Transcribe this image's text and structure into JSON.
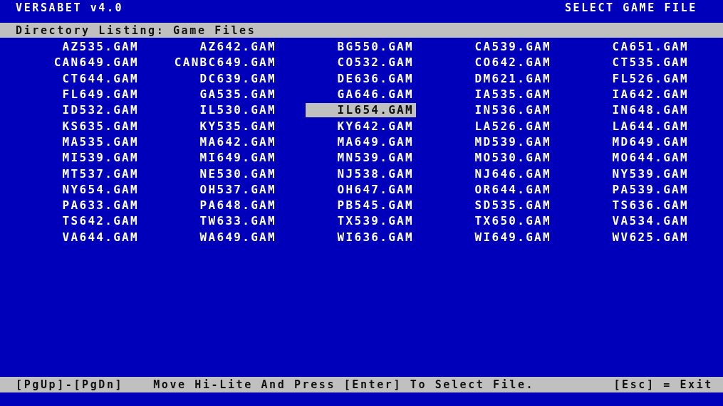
{
  "header": {
    "app_title": "VERSABET v4.0",
    "screen_title": "SELECT GAME FILE"
  },
  "listing": {
    "heading": "Directory Listing: Game Files",
    "files": [
      {
        "name": "AZ535.GAM",
        "selected": false
      },
      {
        "name": "AZ642.GAM",
        "selected": false
      },
      {
        "name": "BG550.GAM",
        "selected": false
      },
      {
        "name": "CA539.GAM",
        "selected": false
      },
      {
        "name": "CA651.GAM",
        "selected": false
      },
      {
        "name": "CAN649.GAM",
        "selected": false
      },
      {
        "name": "CANBC649.GAM",
        "selected": false
      },
      {
        "name": "CO532.GAM",
        "selected": false
      },
      {
        "name": "CO642.GAM",
        "selected": false
      },
      {
        "name": "CT535.GAM",
        "selected": false
      },
      {
        "name": "CT644.GAM",
        "selected": false
      },
      {
        "name": "DC639.GAM",
        "selected": false
      },
      {
        "name": "DE636.GAM",
        "selected": false
      },
      {
        "name": "DM621.GAM",
        "selected": false
      },
      {
        "name": "FL526.GAM",
        "selected": false
      },
      {
        "name": "FL649.GAM",
        "selected": false
      },
      {
        "name": "GA535.GAM",
        "selected": false
      },
      {
        "name": "GA646.GAM",
        "selected": false
      },
      {
        "name": "IA535.GAM",
        "selected": false
      },
      {
        "name": "IA642.GAM",
        "selected": false
      },
      {
        "name": "ID532.GAM",
        "selected": false
      },
      {
        "name": "IL530.GAM",
        "selected": false
      },
      {
        "name": "IL654.GAM",
        "selected": true
      },
      {
        "name": "IN536.GAM",
        "selected": false
      },
      {
        "name": "IN648.GAM",
        "selected": false
      },
      {
        "name": "KS635.GAM",
        "selected": false
      },
      {
        "name": "KY535.GAM",
        "selected": false
      },
      {
        "name": "KY642.GAM",
        "selected": false
      },
      {
        "name": "LA526.GAM",
        "selected": false
      },
      {
        "name": "LA644.GAM",
        "selected": false
      },
      {
        "name": "MA535.GAM",
        "selected": false
      },
      {
        "name": "MA642.GAM",
        "selected": false
      },
      {
        "name": "MA649.GAM",
        "selected": false
      },
      {
        "name": "MD539.GAM",
        "selected": false
      },
      {
        "name": "MD649.GAM",
        "selected": false
      },
      {
        "name": "MI539.GAM",
        "selected": false
      },
      {
        "name": "MI649.GAM",
        "selected": false
      },
      {
        "name": "MN539.GAM",
        "selected": false
      },
      {
        "name": "MO530.GAM",
        "selected": false
      },
      {
        "name": "MO644.GAM",
        "selected": false
      },
      {
        "name": "MT537.GAM",
        "selected": false
      },
      {
        "name": "NE530.GAM",
        "selected": false
      },
      {
        "name": "NJ538.GAM",
        "selected": false
      },
      {
        "name": "NJ646.GAM",
        "selected": false
      },
      {
        "name": "NY539.GAM",
        "selected": false
      },
      {
        "name": "NY654.GAM",
        "selected": false
      },
      {
        "name": "OH537.GAM",
        "selected": false
      },
      {
        "name": "OH647.GAM",
        "selected": false
      },
      {
        "name": "OR644.GAM",
        "selected": false
      },
      {
        "name": "PA539.GAM",
        "selected": false
      },
      {
        "name": "PA633.GAM",
        "selected": false
      },
      {
        "name": "PA648.GAM",
        "selected": false
      },
      {
        "name": "PB545.GAM",
        "selected": false
      },
      {
        "name": "SD535.GAM",
        "selected": false
      },
      {
        "name": "TS636.GAM",
        "selected": false
      },
      {
        "name": "TS642.GAM",
        "selected": false
      },
      {
        "name": "TW633.GAM",
        "selected": false
      },
      {
        "name": "TX539.GAM",
        "selected": false
      },
      {
        "name": "TX650.GAM",
        "selected": false
      },
      {
        "name": "VA534.GAM",
        "selected": false
      },
      {
        "name": "VA644.GAM",
        "selected": false
      },
      {
        "name": "WA649.GAM",
        "selected": false
      },
      {
        "name": "WI636.GAM",
        "selected": false
      },
      {
        "name": "WI649.GAM",
        "selected": false
      },
      {
        "name": "WV625.GAM",
        "selected": false
      }
    ]
  },
  "status_bar": {
    "paging": "[PgUp]-[PgDn]",
    "instruction": "Move Hi-Lite And Press [Enter] To Select File.",
    "exit": "[Esc] = Exit"
  }
}
